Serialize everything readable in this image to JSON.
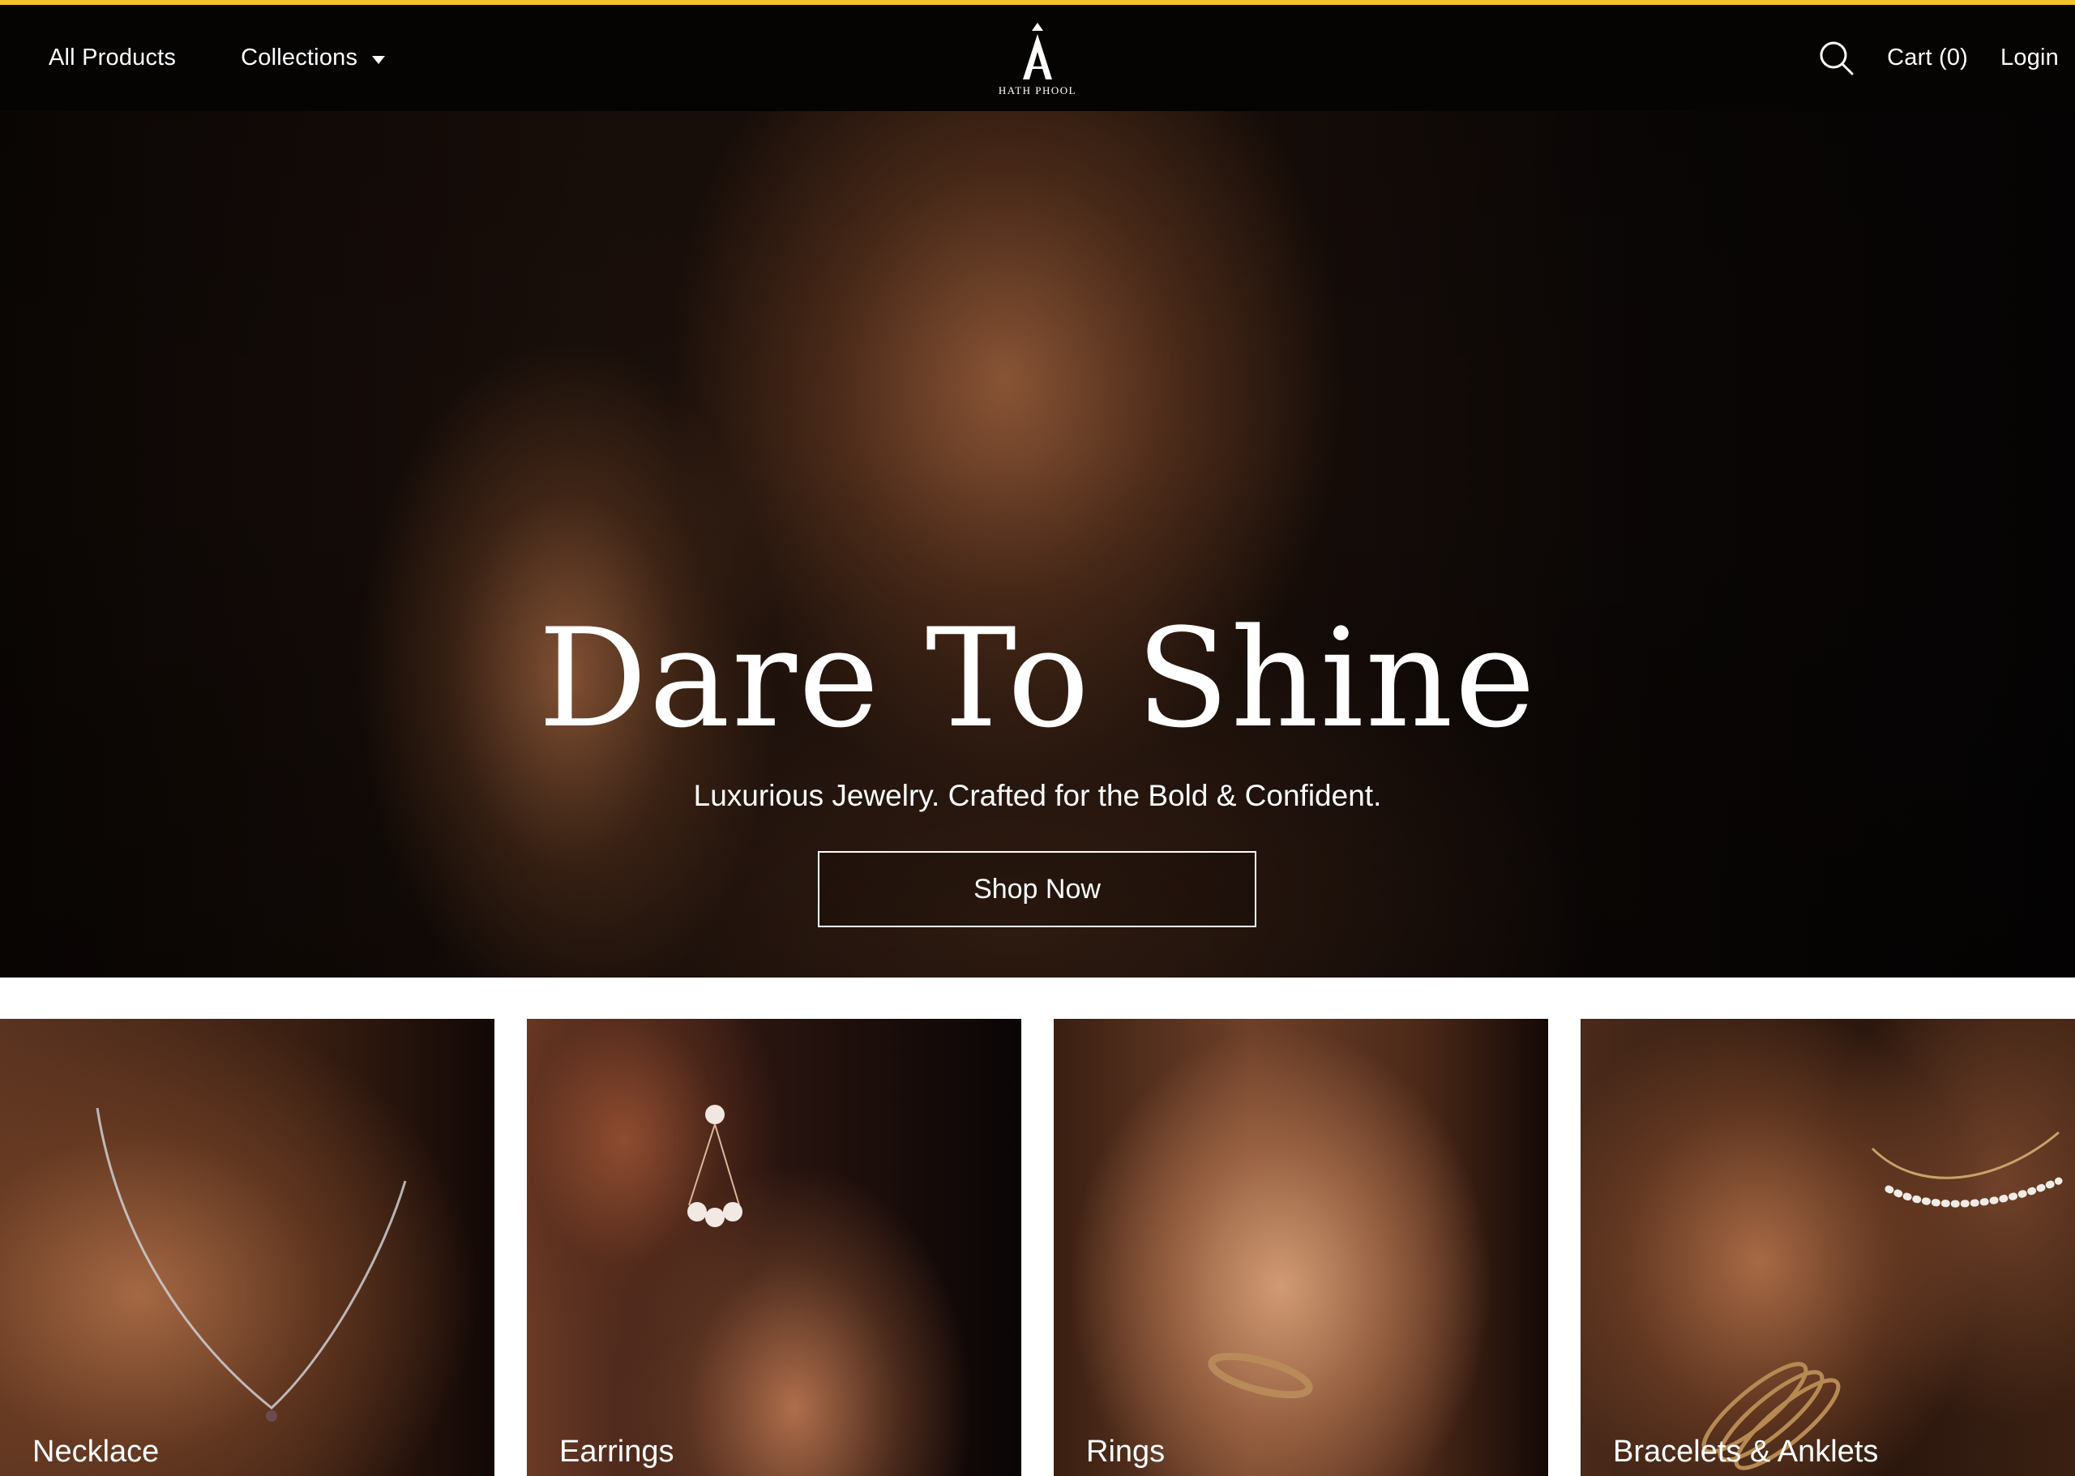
{
  "brand": {
    "logo_text": "HATH PHOOL",
    "accent_color": "#f3c12a",
    "header_bg": "#050403"
  },
  "nav": {
    "all_products": "All Products",
    "collections": "Collections",
    "search_icon": "search-icon",
    "cart": "Cart (0)",
    "login": "Login"
  },
  "hero": {
    "title": "Dare To Shine",
    "subtitle": "Luxurious Jewelry. Crafted for the Bold & Confident.",
    "cta": "Shop Now"
  },
  "categories": [
    {
      "label": "Necklace"
    },
    {
      "label": "Earrings"
    },
    {
      "label": "Rings"
    },
    {
      "label": "Bracelets & Anklets"
    }
  ]
}
